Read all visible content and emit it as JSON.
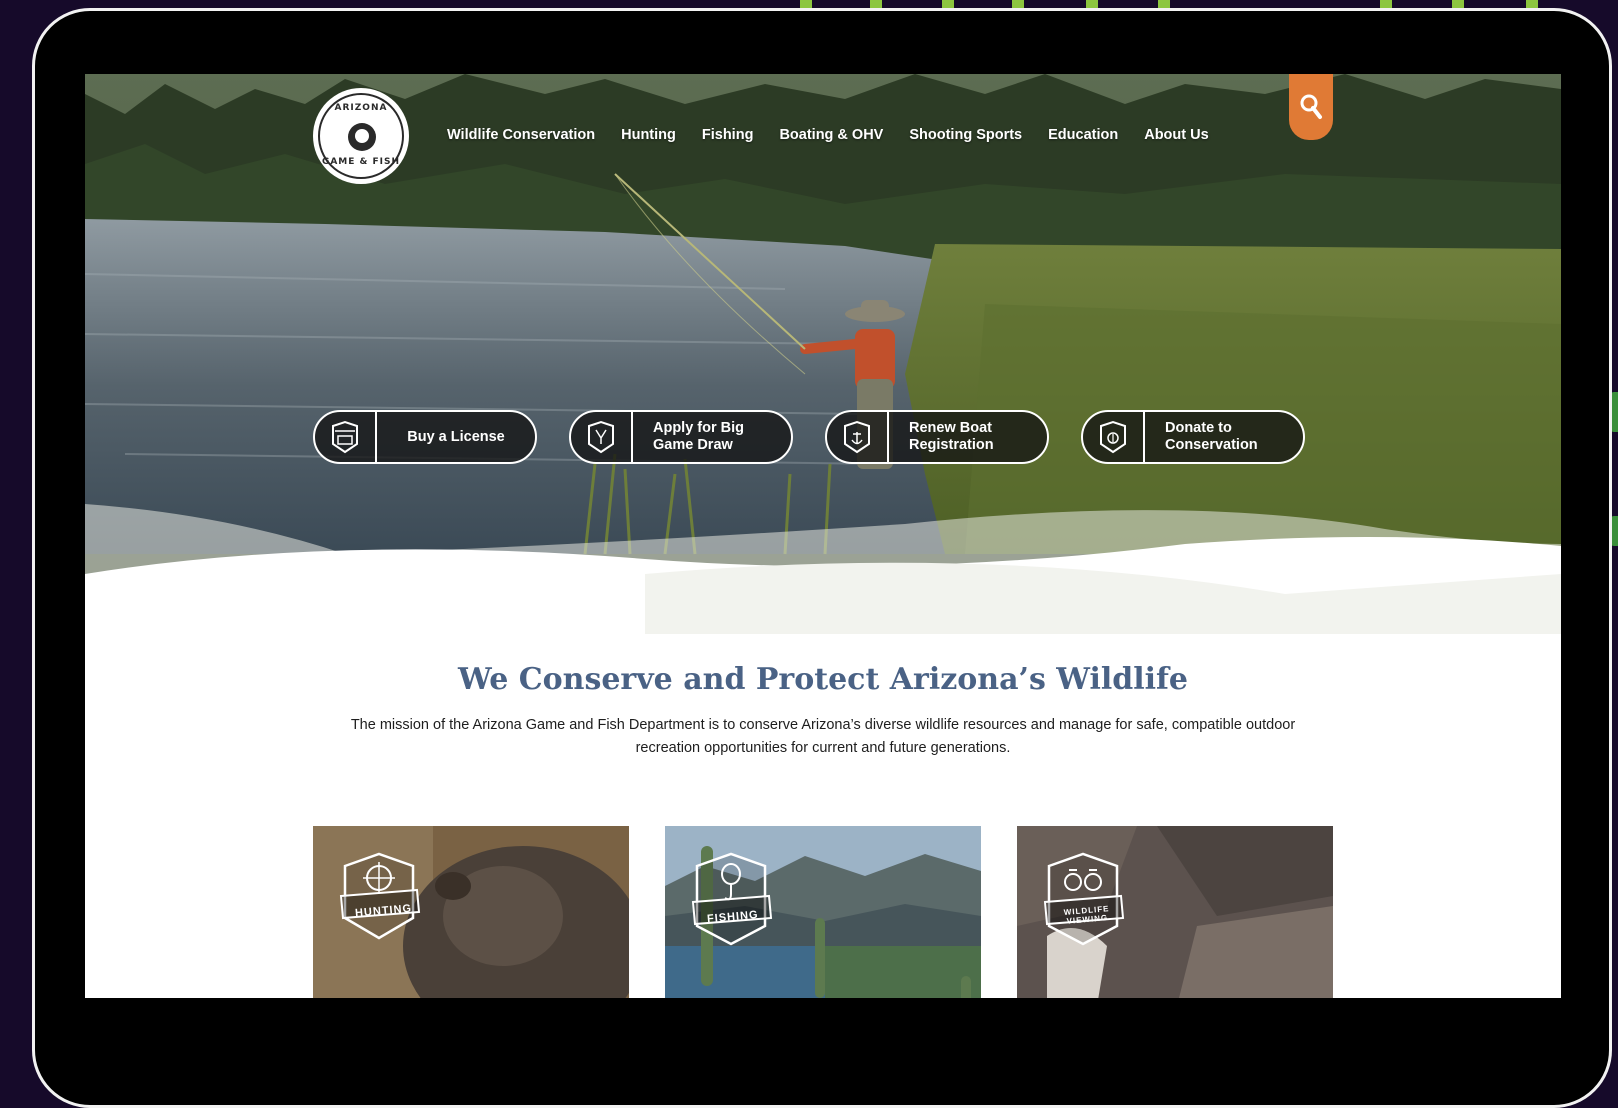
{
  "logo": {
    "top_text": "ARIZONA",
    "bottom_text": "GAME & FISH"
  },
  "nav": {
    "items": [
      "Wildlife Conservation",
      "Hunting",
      "Fishing",
      "Boating & OHV",
      "Shooting Sports",
      "Education",
      "About Us"
    ]
  },
  "search": {
    "icon": "search-icon"
  },
  "actions": [
    {
      "label_line1": "Buy a License",
      "label_line2": "",
      "icon": "license-badge-icon"
    },
    {
      "label_line1": "Apply for Big",
      "label_line2": "Game Draw",
      "icon": "apply-badge-icon"
    },
    {
      "label_line1": "Renew Boat",
      "label_line2": "Registration",
      "icon": "boat-badge-icon"
    },
    {
      "label_line1": "Donate to",
      "label_line2": "Conservation",
      "icon": "donate-badge-icon"
    }
  ],
  "mission": {
    "title": "We Conserve and Protect Arizona’s Wildlife",
    "text": "The mission of the Arizona Game and Fish Department is to conserve Arizona’s diverse wildlife resources and manage for safe, compatible outdoor recreation opportunities for current and future generations."
  },
  "cards": [
    {
      "label": "HUNTING",
      "icon": "crosshair-badge-icon"
    },
    {
      "label": "FISHING",
      "icon": "lure-badge-icon"
    },
    {
      "label": "WILDLIFE VIEWING",
      "icon": "binoculars-badge-icon"
    }
  ],
  "colors": {
    "accent_orange": "#e07a35",
    "title_blue": "#4a6285",
    "page_background": "#160a2a",
    "stripe_green": "#8cc63f"
  }
}
